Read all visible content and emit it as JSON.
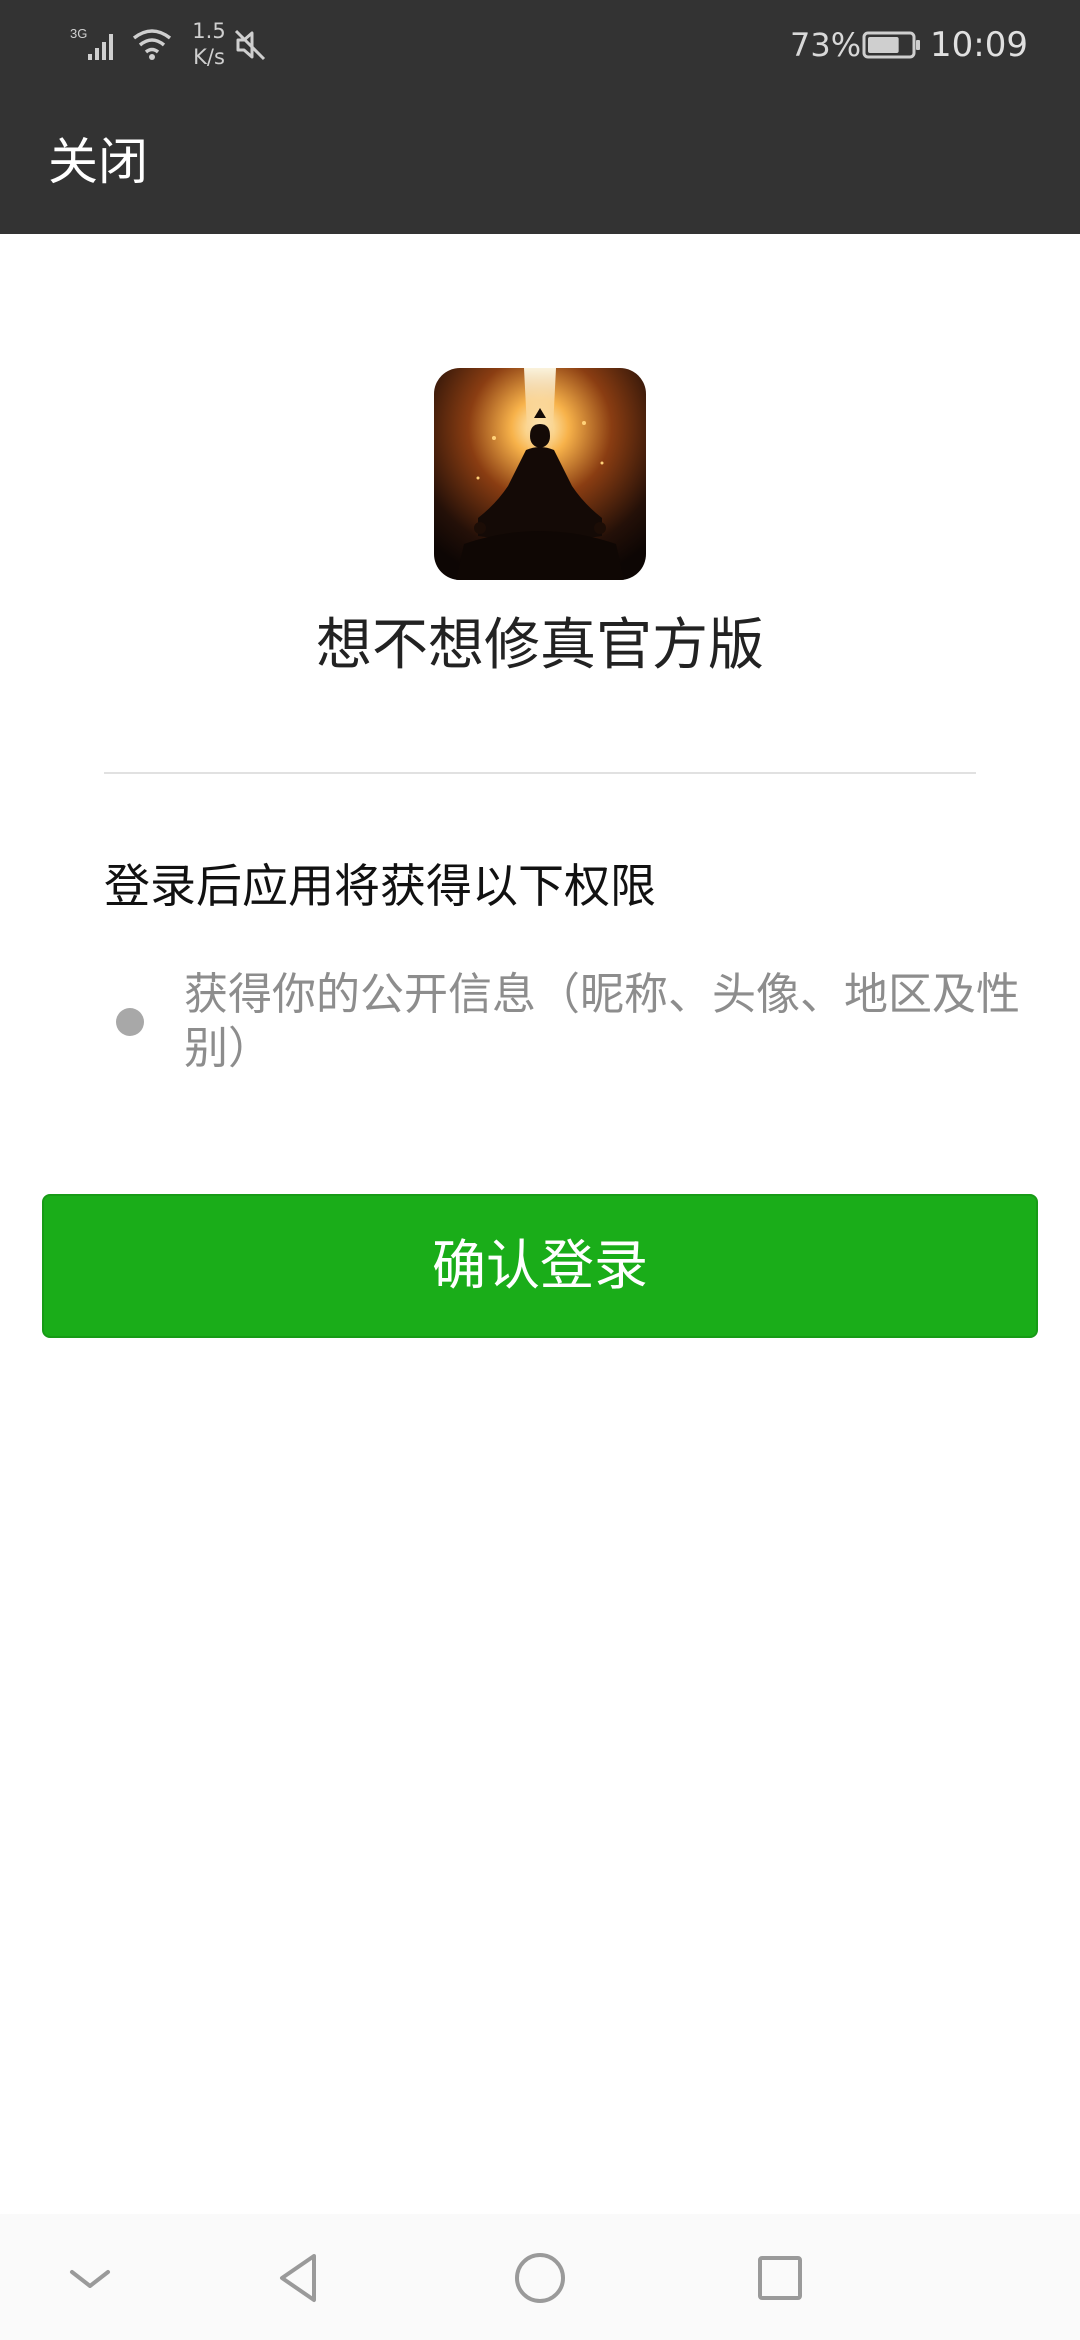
{
  "status_bar": {
    "network_type": "3G",
    "speed_value": "1.5",
    "speed_unit": "K/s",
    "battery_percent": "73%",
    "battery_level": 0.73,
    "time": "10:09",
    "icons": [
      "signal-icon",
      "wifi-icon",
      "mute-icon",
      "battery-icon"
    ]
  },
  "title_bar": {
    "close_label": "关闭"
  },
  "app": {
    "name": "想不想修真官方版",
    "icon": "meditating-cultivator-app-icon"
  },
  "permissions": {
    "heading": "登录后应用将获得以下权限",
    "items": [
      {
        "text": "获得你的公开信息（昵称、头像、地区及性别）"
      }
    ]
  },
  "confirm_button": {
    "label": "确认登录",
    "color": "#1aad19"
  },
  "nav_bar": {
    "icons": [
      "chevron-down-icon",
      "back-icon",
      "home-icon",
      "recents-icon"
    ]
  },
  "colors": {
    "header_background": "#333333",
    "accent_green": "#1aad19"
  }
}
